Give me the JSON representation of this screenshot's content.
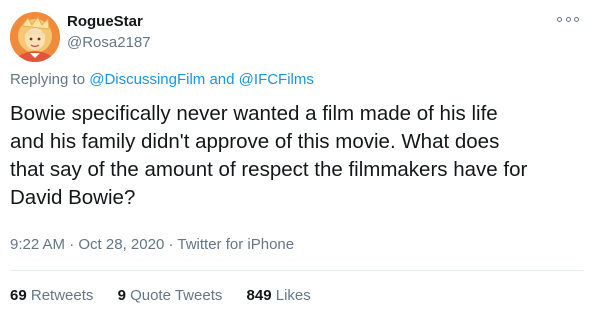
{
  "author": {
    "display_name": "RogueStar",
    "handle": "@Rosa2187",
    "avatar_icon": "profile-avatar-icon"
  },
  "more_icon": "more-options-icon",
  "reply": {
    "prefix": "Replying to",
    "mention_1": "@DiscussingFilm",
    "joiner": "and",
    "mention_2": "@IFCFilms"
  },
  "tweet_lines": [
    "Bowie specifically never wanted a film made of his life",
    "and his family didn't approve of this movie. What does",
    "that say of the amount of respect the filmmakers have for",
    "David Bowie?"
  ],
  "meta": {
    "time": "9:22 AM",
    "sep1": "·",
    "date": "Oct 28, 2020",
    "sep2": "·",
    "source": "Twitter for iPhone"
  },
  "stats": {
    "retweets_count": "69",
    "retweets_label": "Retweets",
    "quotes_count": "9",
    "quotes_label": "Quote Tweets",
    "likes_count": "849",
    "likes_label": "Likes"
  },
  "colors": {
    "link": "#1b95e0",
    "secondary_text": "#657786",
    "primary_text": "#14171a",
    "divider": "#e6ecf0"
  }
}
